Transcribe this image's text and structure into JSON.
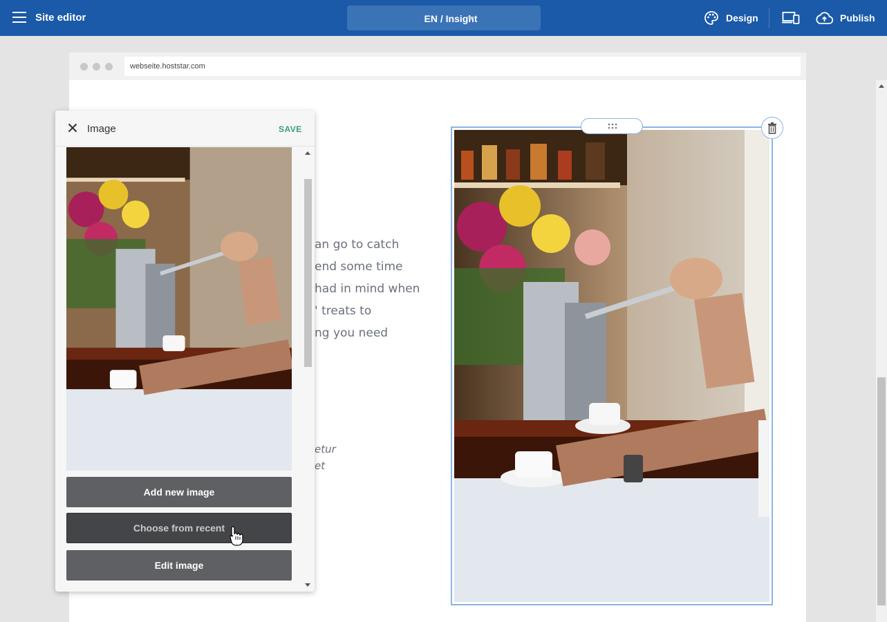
{
  "topbar": {
    "title": "Site editor",
    "language_page": "EN / Insight",
    "design_label": "Design",
    "publish_label": "Publish",
    "background": "#1a5aa8"
  },
  "browser": {
    "url": "webseite.hoststar.com"
  },
  "site": {
    "body_text": "an go to catch\nend some time\nhad in mind when\n' treats to\nng you need",
    "italic_text": "etur\net"
  },
  "panel": {
    "title": "Image",
    "save_label": "SAVE",
    "buttons": {
      "add": "Add new image",
      "recent": "Choose from recent",
      "edit": "Edit image"
    }
  },
  "icons": {
    "menu": "hamburger-icon",
    "design": "palette-icon",
    "devices": "devices-icon",
    "publish": "cloud-upload-icon",
    "close": "close-icon",
    "drag": "drag-grip-icon",
    "delete": "trash-icon",
    "cursor": "hand-pointer-icon"
  }
}
